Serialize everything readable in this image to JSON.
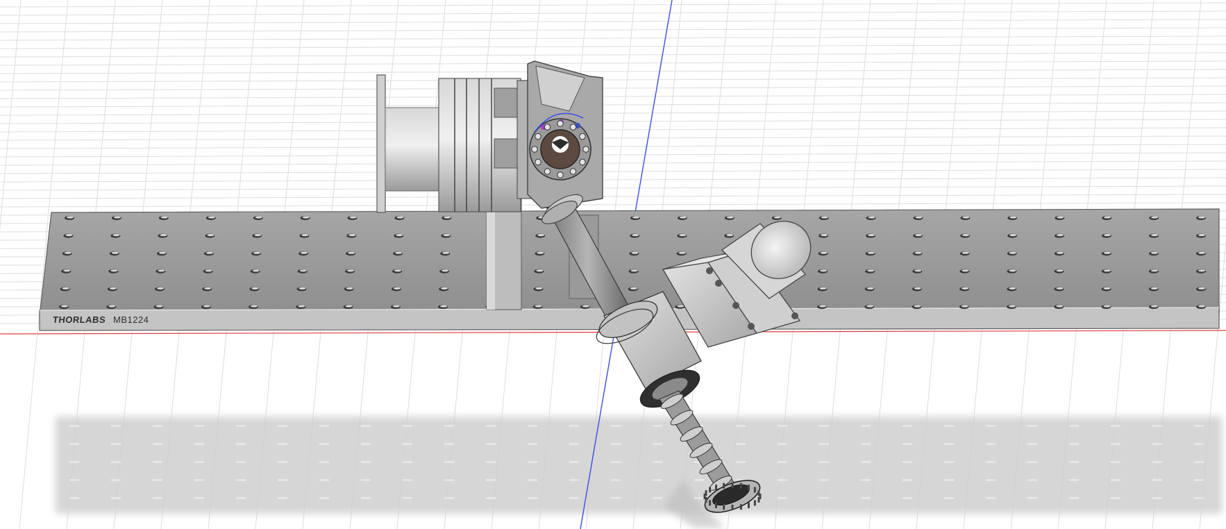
{
  "viewport": {
    "background": "#ffffff",
    "grid_color": "#d9dde1",
    "x_axis_color": "#e23b3b",
    "z_axis_color": "#3a4ee8"
  },
  "breadboard": {
    "top_color": "#9c9c9c",
    "edge_color": "#bdbdbd",
    "hole_color": "#3a3a3a",
    "engraving": {
      "brand": "THORLABS",
      "part": "MB1224"
    }
  },
  "assembly": {
    "metal_color": "#bfbfbf",
    "dark_metal_color": "#6e6e6e",
    "shadow_color": "#c8c8c8"
  }
}
